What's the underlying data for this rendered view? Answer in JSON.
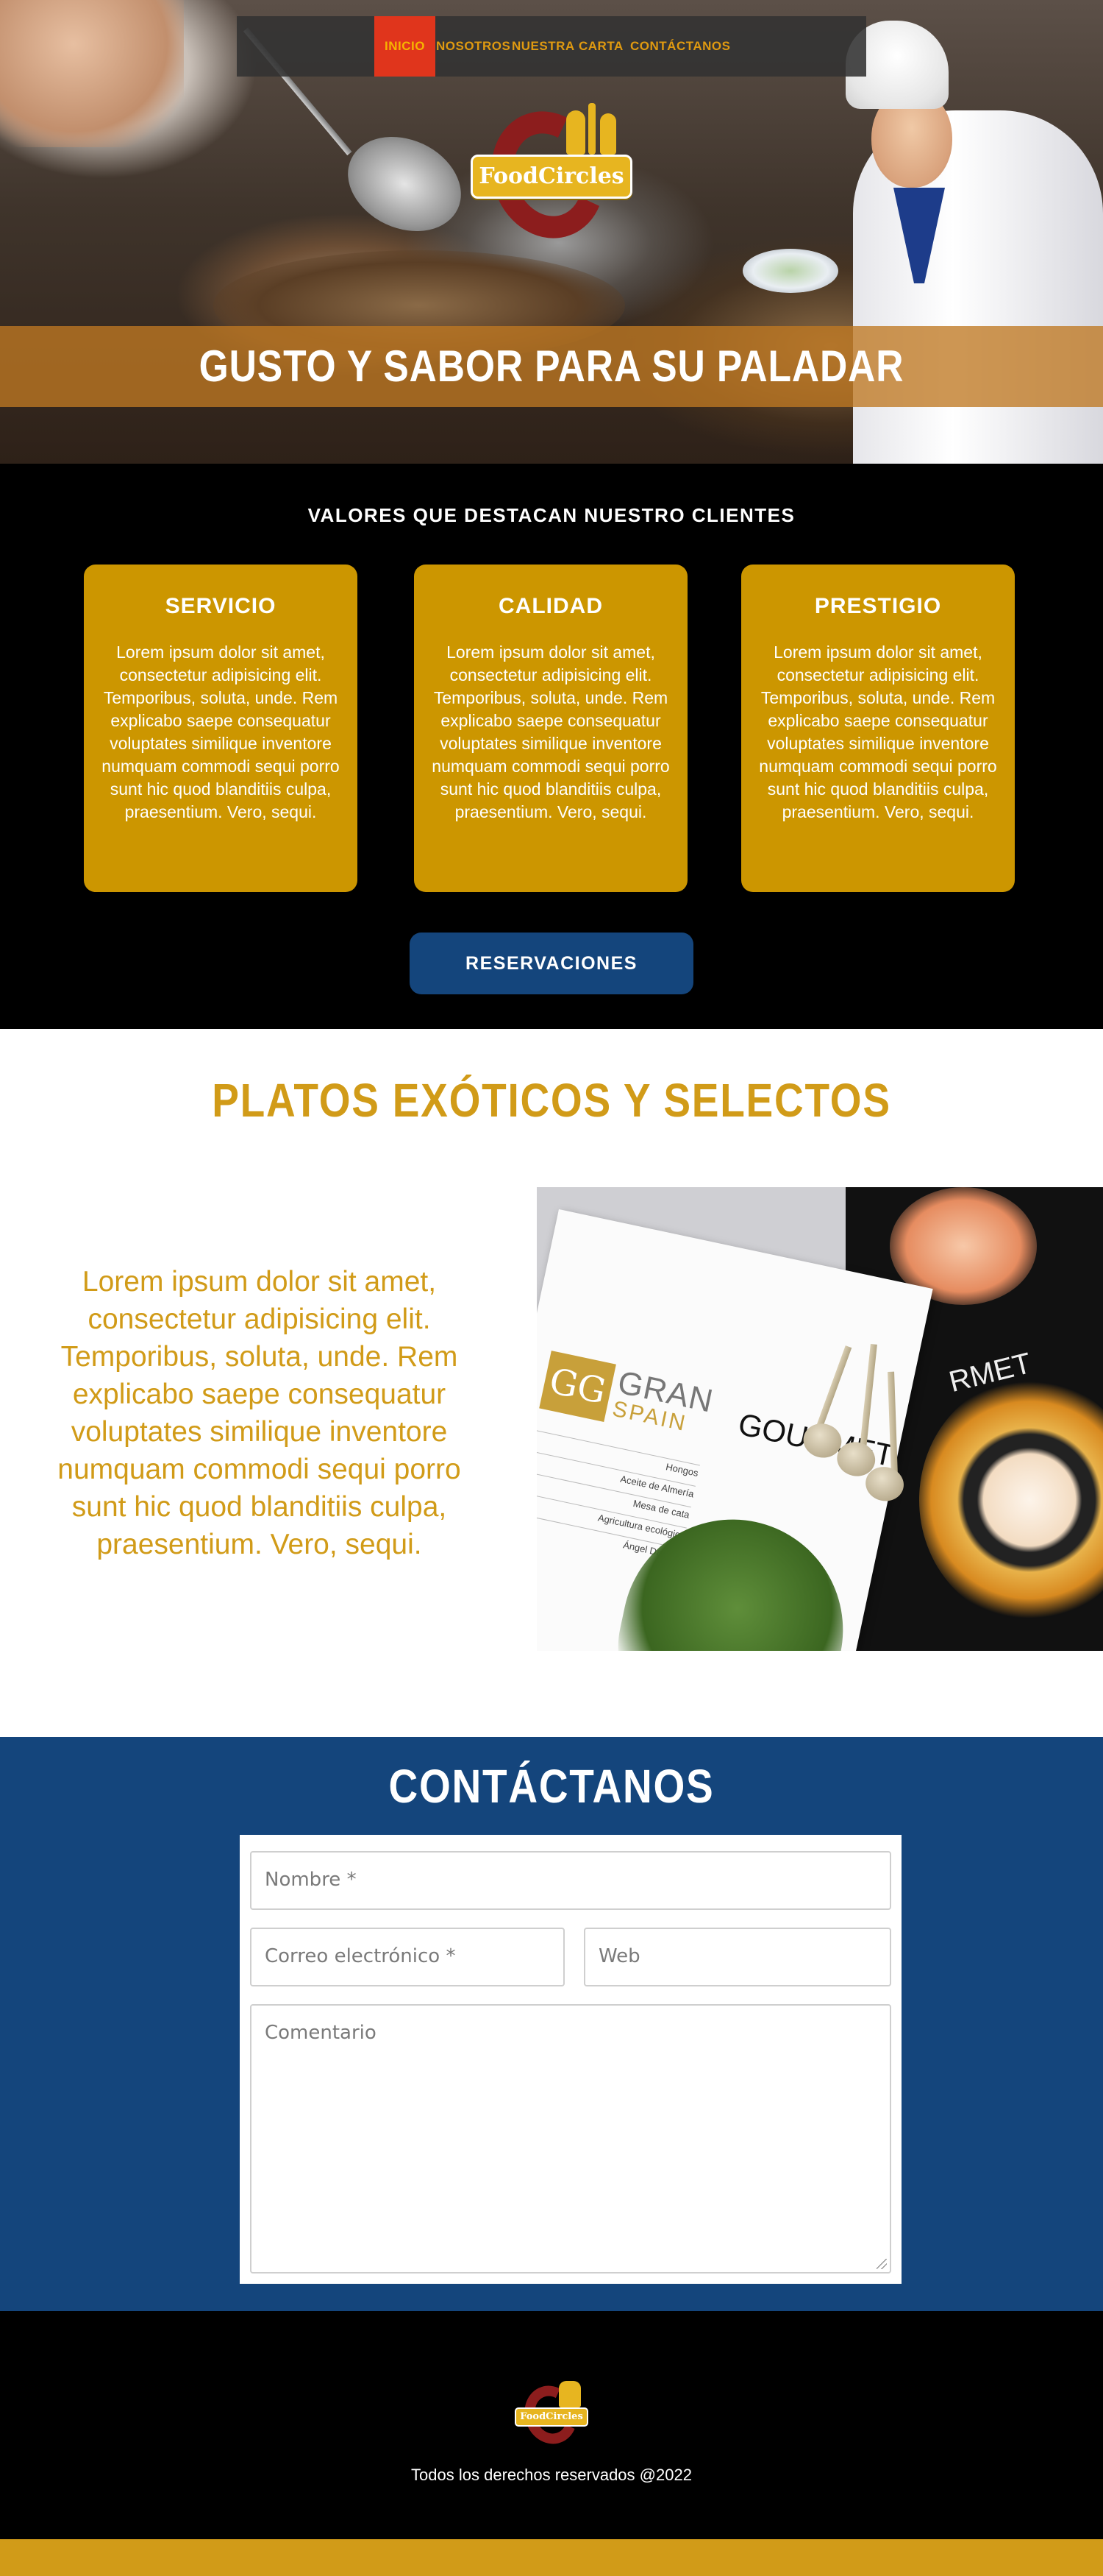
{
  "nav": {
    "items": [
      {
        "label": "INICIO",
        "active": true
      },
      {
        "label": "NOSOTROS",
        "active": false
      },
      {
        "label": "NUESTRA",
        "active": false
      },
      {
        "label": "CARTA",
        "active": false
      },
      {
        "label": "CONTÁCTANOS",
        "active": false
      }
    ]
  },
  "brand": {
    "logo_text": "FoodCircles",
    "colors": {
      "gold": "#cc9600",
      "dark_red": "#8c1d1d",
      "blue": "#14457c",
      "accent_red": "#e0351c"
    }
  },
  "hero": {
    "title": "GUSTO Y SABOR PARA SU PALADAR"
  },
  "values": {
    "title": "VALORES QUE DESTACAN NUESTRO CLIENTES",
    "cards": [
      {
        "title": "SERVICIO",
        "text": "Lorem ipsum dolor sit amet, consectetur adipisicing elit. Temporibus, soluta, unde. Rem explicabo saepe consequatur voluptates similique inventore numquam commodi sequi porro sunt hic quod blanditiis culpa, praesentium. Vero, sequi."
      },
      {
        "title": "CALIDAD",
        "text": "Lorem ipsum dolor sit amet, consectetur adipisicing elit. Temporibus, soluta, unde. Rem explicabo saepe consequatur voluptates similique inventore numquam commodi sequi porro sunt hic quod blanditiis culpa, praesentium. Vero, sequi."
      },
      {
        "title": "PRESTIGIO",
        "text": "Lorem ipsum dolor sit amet, consectetur adipisicing elit. Temporibus, soluta, unde. Rem explicabo saepe consequatur voluptates similique inventore numquam commodi sequi porro sunt hic quod blanditiis culpa, praesentium. Vero, sequi."
      }
    ],
    "button_label": "RESERVACIONES"
  },
  "dishes": {
    "title": "PLATOS EXÓTICOS Y SELECTOS",
    "text": "Lorem ipsum dolor sit amet, consectetur adipisicing elit. Temporibus, soluta, unde. Rem explicabo saepe consequatur voluptates similique inventore numquam commodi sequi porro sunt hic quod blanditiis culpa, praesentium. Vero, sequi.",
    "magazine": {
      "monogram": "GG",
      "gran": "GRAN",
      "spain": "SPAIN",
      "gourmet": "GOURMET",
      "gourmet_cut": "RMET",
      "list": [
        "Hongos",
        "Aceite de Almería",
        "Mesa de cata",
        "Agricultura ecológica",
        "Ángel Dascila"
      ]
    }
  },
  "contact": {
    "title": "CONTÁCTANOS",
    "name_placeholder": "Nombre *",
    "email_placeholder": "Correo electrónico *",
    "web_placeholder": "Web",
    "comment_placeholder": "Comentario"
  },
  "footer": {
    "logo_text": "FoodCircles",
    "copyright": "Todos los derechos reservados @2022"
  }
}
